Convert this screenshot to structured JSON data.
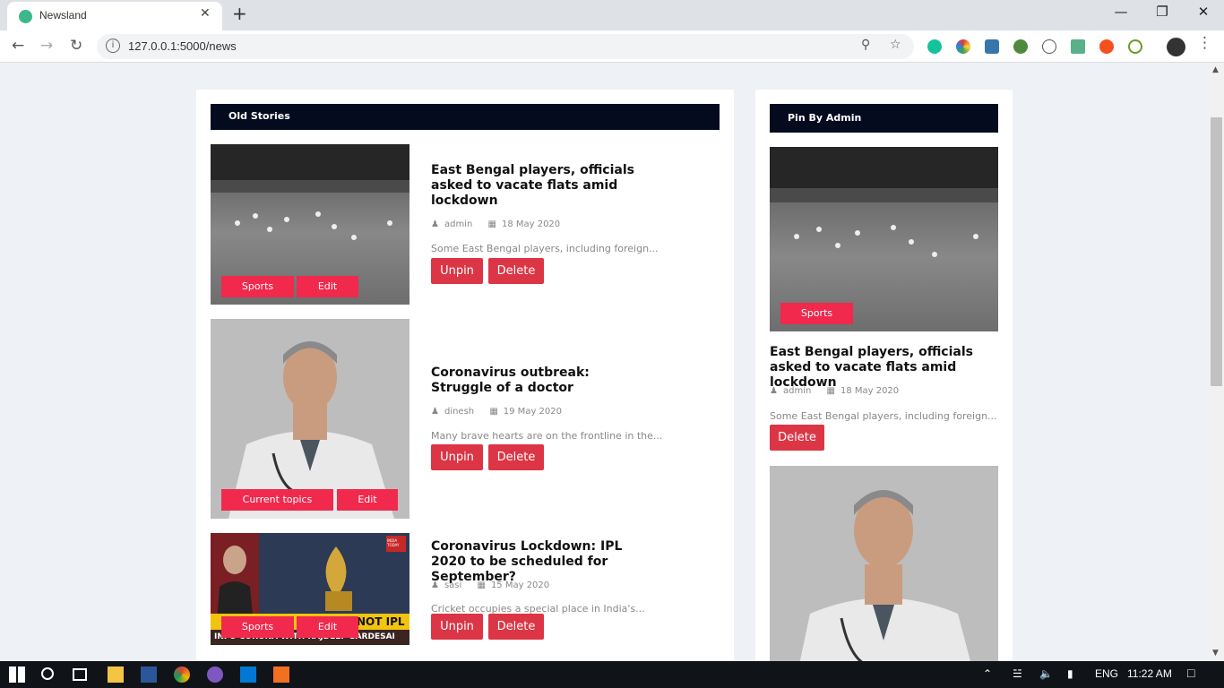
{
  "browser": {
    "tab_title": "Newsland",
    "new_tab": "+",
    "close_tab": "✕",
    "url": "127.0.0.1:5000/news"
  },
  "old_stories": {
    "heading": "Old Stories",
    "items": [
      {
        "headline": "East Bengal players, officials asked to vacate flats amid lockdown",
        "author": "admin",
        "date": "18 May 2020",
        "excerpt": "Some East Bengal players, including foreign...",
        "category": "Sports",
        "edit": "Edit",
        "unpin": "Unpin",
        "delete": "Delete"
      },
      {
        "headline": "Coronavirus outbreak: Struggle of a doctor",
        "author": "dinesh",
        "date": "19 May 2020",
        "excerpt": "Many brave hearts are on the frontline in the...",
        "category": "Current topics",
        "edit": "Edit",
        "unpin": "Unpin",
        "delete": "Delete"
      },
      {
        "headline": "Coronavirus Lockdown: IPL 2020 to be scheduled for September?",
        "author": "sasi",
        "date": "15 May 2020",
        "excerpt": "Cricket occupies a special place in India's...",
        "category": "Sports",
        "edit": "Edit",
        "unpin": "Unpin",
        "delete": "Delete",
        "image_text_1": "NOT IPL",
        "image_text_2": "INFO CORONA WITH RAJDEEP SARDESAI",
        "image_logo": "INDIA TODAY"
      }
    ]
  },
  "pinned": {
    "heading": "Pin By Admin",
    "items": [
      {
        "headline": "East Bengal players, officials asked to vacate flats amid lockdown",
        "author": "admin",
        "date": "18 May 2020",
        "excerpt": "Some East Bengal players, including foreign...",
        "category": "Sports",
        "delete": "Delete"
      }
    ]
  },
  "taskbar": {
    "lang": "ENG",
    "time": "11:22 AM"
  },
  "colors": {
    "accent": "#f0294d",
    "danger": "#dc3545",
    "header": "#050b1f"
  }
}
